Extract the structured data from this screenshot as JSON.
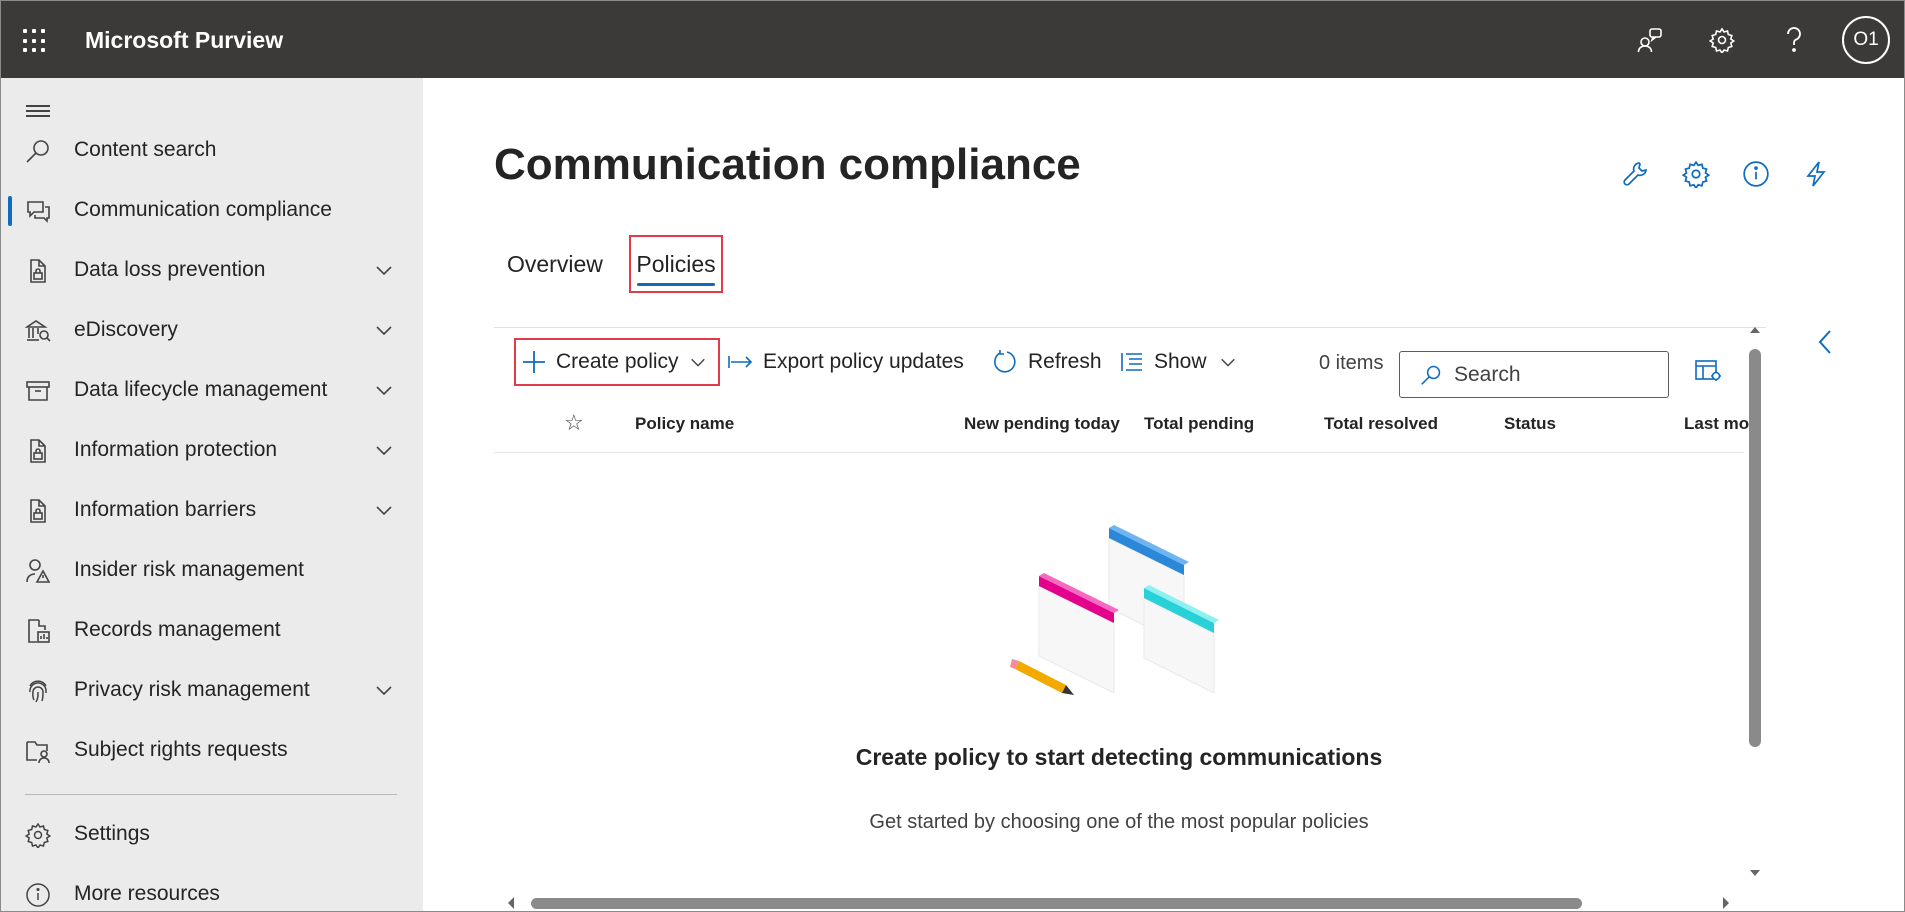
{
  "app": {
    "title": "Microsoft Purview",
    "avatar_initials": "O1",
    "top_icons": [
      "community-icon",
      "gear-icon",
      "help-icon"
    ]
  },
  "sidebar": {
    "items": [
      {
        "label": "Content search",
        "icon": "search-icon",
        "expandable": false,
        "active": false
      },
      {
        "label": "Communication compliance",
        "icon": "chat-icon",
        "expandable": false,
        "active": true
      },
      {
        "label": "Data loss prevention",
        "icon": "lock-doc-icon",
        "expandable": true,
        "active": false
      },
      {
        "label": "eDiscovery",
        "icon": "bank-icon",
        "expandable": true,
        "active": false
      },
      {
        "label": "Data lifecycle management",
        "icon": "archive-icon",
        "expandable": true,
        "active": false
      },
      {
        "label": "Information protection",
        "icon": "lock-doc-icon",
        "expandable": true,
        "active": false
      },
      {
        "label": "Information barriers",
        "icon": "lock-doc-icon",
        "expandable": true,
        "active": false
      },
      {
        "label": "Insider risk management",
        "icon": "person-warning-icon",
        "expandable": false,
        "active": false
      },
      {
        "label": "Records management",
        "icon": "records-icon",
        "expandable": false,
        "active": false
      },
      {
        "label": "Privacy risk management",
        "icon": "fingerprint-icon",
        "expandable": true,
        "active": false
      },
      {
        "label": "Subject rights requests",
        "icon": "folder-person-icon",
        "expandable": false,
        "active": false
      }
    ],
    "footer_items": [
      {
        "label": "Settings",
        "icon": "gear-icon"
      },
      {
        "label": "More resources",
        "icon": "info-icon"
      }
    ],
    "active_color": "#0f6cbd"
  },
  "main": {
    "page_title": "Communication compliance",
    "header_actions": [
      "wrench-icon",
      "gear-icon",
      "info-icon",
      "lightning-icon"
    ],
    "tabs": [
      {
        "label": "Overview",
        "selected": false
      },
      {
        "label": "Policies",
        "selected": true
      }
    ],
    "toolbar": {
      "create_label": "Create policy",
      "export_label": "Export policy updates",
      "refresh_label": "Refresh",
      "show_label": "Show",
      "items_count": "0 items",
      "search_placeholder": "Search"
    },
    "table": {
      "columns": [
        "Policy name",
        "New pending today",
        "Total pending",
        "Total resolved",
        "Status",
        "Last mo"
      ]
    },
    "empty_state": {
      "title": "Create policy to start detecting communications",
      "subtitle": "Get started by choosing one of the most popular policies"
    }
  },
  "colors": {
    "topbar": "#3b3a39",
    "sidebar": "#ebebeb",
    "accent": "#0f6cbd",
    "highlight_box": "#e03b4b"
  }
}
